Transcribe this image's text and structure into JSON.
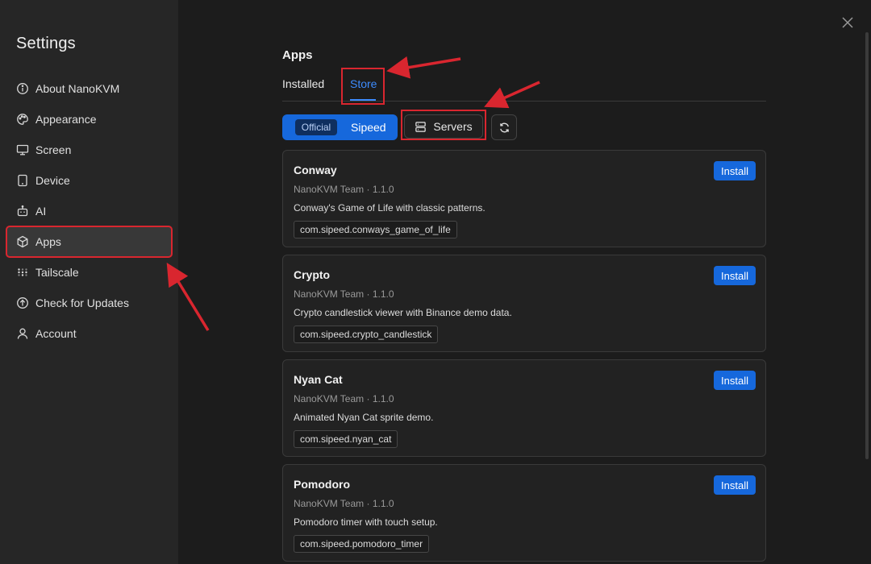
{
  "sidebar": {
    "title": "Settings",
    "items": [
      {
        "label": "About NanoKVM",
        "icon": "info-icon"
      },
      {
        "label": "Appearance",
        "icon": "palette-icon"
      },
      {
        "label": "Screen",
        "icon": "monitor-icon"
      },
      {
        "label": "Device",
        "icon": "tablet-icon"
      },
      {
        "label": "AI",
        "icon": "robot-icon"
      },
      {
        "label": "Apps",
        "icon": "cube-icon",
        "active": true
      },
      {
        "label": "Tailscale",
        "icon": "dots-grid-icon"
      },
      {
        "label": "Check for Updates",
        "icon": "arrow-up-circle-icon"
      },
      {
        "label": "Account",
        "icon": "user-icon"
      }
    ]
  },
  "main": {
    "title": "Apps",
    "tabs": {
      "installed": "Installed",
      "store": "Store",
      "active": "Store"
    },
    "toolbar": {
      "official_label": "Official",
      "sipeed_label": "Sipeed",
      "servers_label": "Servers"
    },
    "apps": [
      {
        "name": "Conway",
        "meta": "NanoKVM Team · 1.1.0",
        "description": "Conway's Game of Life with classic patterns.",
        "id": "com.sipeed.conways_game_of_life",
        "action": "Install"
      },
      {
        "name": "Crypto",
        "meta": "NanoKVM Team · 1.1.0",
        "description": "Crypto candlestick viewer with Binance demo data.",
        "id": "com.sipeed.crypto_candlestick",
        "action": "Install"
      },
      {
        "name": "Nyan Cat",
        "meta": "NanoKVM Team · 1.1.0",
        "description": "Animated Nyan Cat sprite demo.",
        "id": "com.sipeed.nyan_cat",
        "action": "Install"
      },
      {
        "name": "Pomodoro",
        "meta": "NanoKVM Team · 1.1.0",
        "description": "Pomodoro timer with touch setup.",
        "id": "com.sipeed.pomodoro_timer",
        "action": "Install"
      }
    ]
  },
  "colors": {
    "accent": "#1668dc",
    "link": "#3d8bfd",
    "annotation": "#d9262f"
  }
}
